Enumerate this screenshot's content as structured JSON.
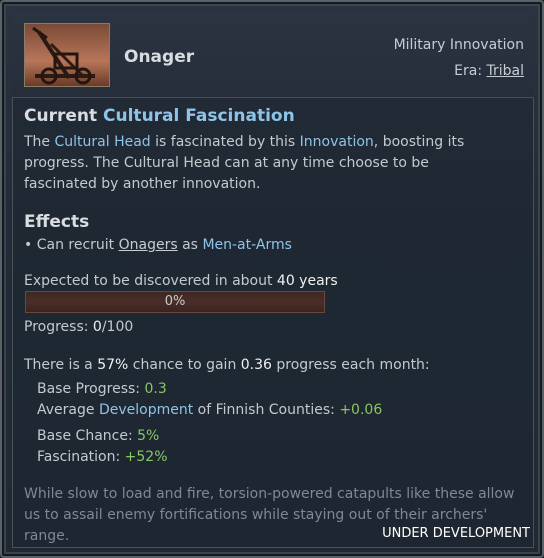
{
  "header": {
    "title": "Onager",
    "category": "Military Innovation",
    "era_label": "Era:",
    "era_value": "Tribal",
    "portrait_icon": "onager-siege-engine-illustration"
  },
  "fascination": {
    "heading_prefix": "Current",
    "heading_highlight": "Cultural Fascination",
    "p1_a": "The ",
    "p1_hl1": "Cultural Head",
    "p1_b": " is fascinated by this ",
    "p1_hl2": "Innovation",
    "p1_c": ", boosting its progress. The Cultural Head can at any time choose to be fascinated by another innovation."
  },
  "effects": {
    "heading": "Effects",
    "bullet": "•",
    "item_a": "Can recruit ",
    "item_link": "Onagers",
    "item_b": " as ",
    "item_hl": "Men-at-Arms"
  },
  "discovery": {
    "expected_prefix": "Expected to be discovered in about ",
    "expected_value": "40 years",
    "bar_label": "0%",
    "bar_fraction": 0,
    "progress_prefix": "Progress: ",
    "progress_value": "0",
    "progress_total": "/100"
  },
  "chance": {
    "line_a": "There is a ",
    "pct": "57%",
    "line_b": " chance to gain ",
    "amount": "0.36",
    "line_c": " progress each month:",
    "base_progress_label": "Base Progress: ",
    "base_progress_value": "0.3",
    "avg_dev_a": "Average ",
    "avg_dev_hl": "Development",
    "avg_dev_b": " of Finnish Counties: ",
    "avg_dev_value": "+0.06",
    "base_chance_label": "Base Chance: ",
    "base_chance_value": "5%",
    "fascination_label": "Fascination: ",
    "fascination_value": "+52%"
  },
  "flavor": "While slow to load and fire, torsion-powered catapults like these allow us to assail enemy fortifications while staying out of their archers' range.",
  "watermark": "UNDER DEVELOPMENT",
  "colors": {
    "highlight": "#8ec4e8",
    "positive": "#86c763",
    "progress_bar": "#4a2e28"
  }
}
